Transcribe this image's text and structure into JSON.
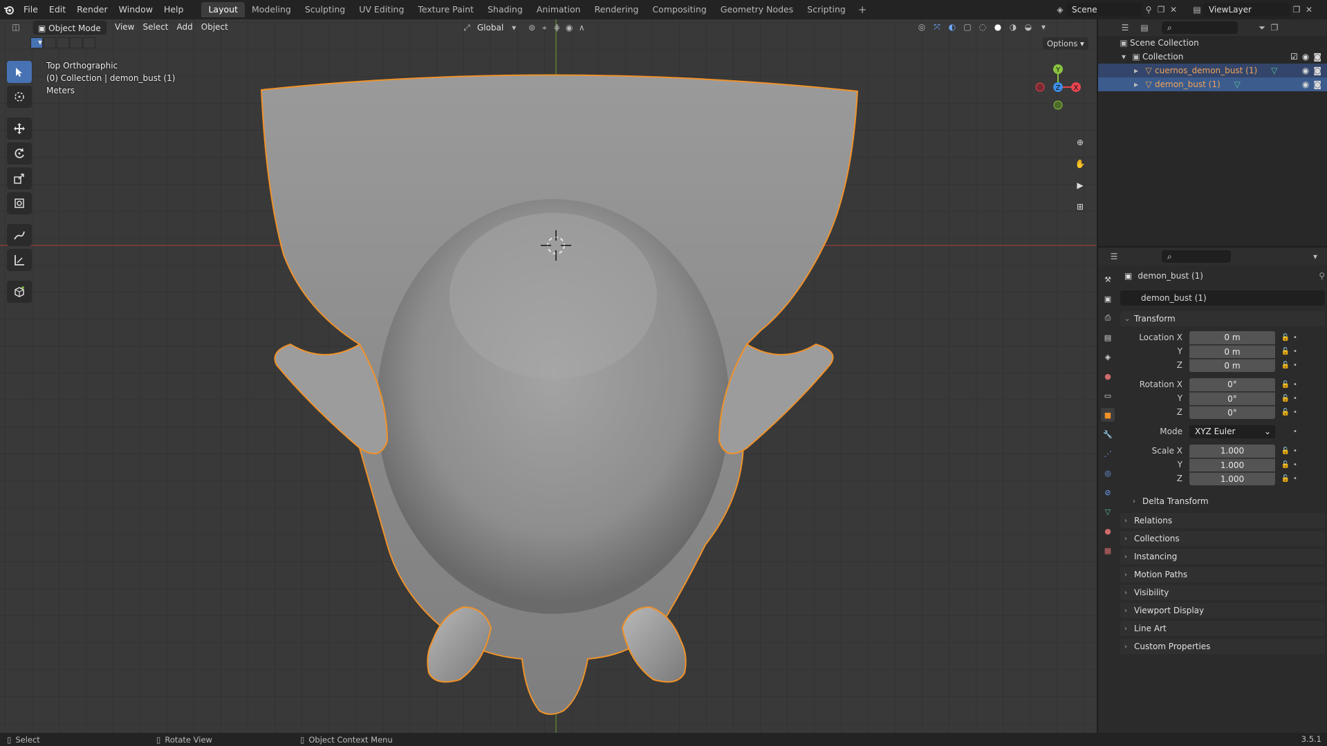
{
  "menus": [
    "File",
    "Edit",
    "Render",
    "Window",
    "Help"
  ],
  "workspaces": [
    "Layout",
    "Modeling",
    "Sculpting",
    "UV Editing",
    "Texture Paint",
    "Shading",
    "Animation",
    "Rendering",
    "Compositing",
    "Geometry Nodes",
    "Scripting"
  ],
  "active_workspace": "Layout",
  "scene": "Scene",
  "view_layer": "ViewLayer",
  "viewport": {
    "mode": "Object Mode",
    "menus": [
      "View",
      "Select",
      "Add",
      "Object"
    ],
    "transform_orientation": "Global",
    "options_label": "Options",
    "info_view": "Top Orthographic",
    "info_collection": "(0) Collection | demon_bust (1)",
    "info_units": "Meters",
    "gizmo": {
      "x": "X",
      "y": "Y",
      "z": "Z"
    }
  },
  "outliner": {
    "scene_collection": "Scene Collection",
    "collection": "Collection",
    "items": [
      {
        "name": "cuernos_demon_bust (1)",
        "selected": true,
        "active": false
      },
      {
        "name": "demon_bust (1)",
        "selected": true,
        "active": true
      }
    ]
  },
  "properties": {
    "object_title": "demon_bust (1)",
    "object_name": "demon_bust (1)",
    "transform_header": "Transform",
    "location": {
      "label": "Location X",
      "x": "0 m",
      "y": "0 m",
      "z": "0 m"
    },
    "rotation": {
      "label": "Rotation X",
      "x": "0°",
      "y": "0°",
      "z": "0°"
    },
    "mode_label": "Mode",
    "mode_value": "XYZ Euler",
    "scale": {
      "label": "Scale X",
      "x": "1.000",
      "y": "1.000",
      "z": "1.000"
    },
    "axis_y": "Y",
    "axis_z": "Z",
    "delta_transform": "Delta Transform",
    "panels": [
      "Relations",
      "Collections",
      "Instancing",
      "Motion Paths",
      "Visibility",
      "Viewport Display",
      "Line Art",
      "Custom Properties"
    ]
  },
  "statusbar": {
    "select": "Select",
    "rotate": "Rotate View",
    "context": "Object Context Menu",
    "version": "3.5.1"
  },
  "colors": {
    "accent": "#4772b3",
    "selection_outline": "#f0922a",
    "x_axis": "#e8444f",
    "y_axis": "#8bc541",
    "z_axis": "#3d8ee8"
  }
}
